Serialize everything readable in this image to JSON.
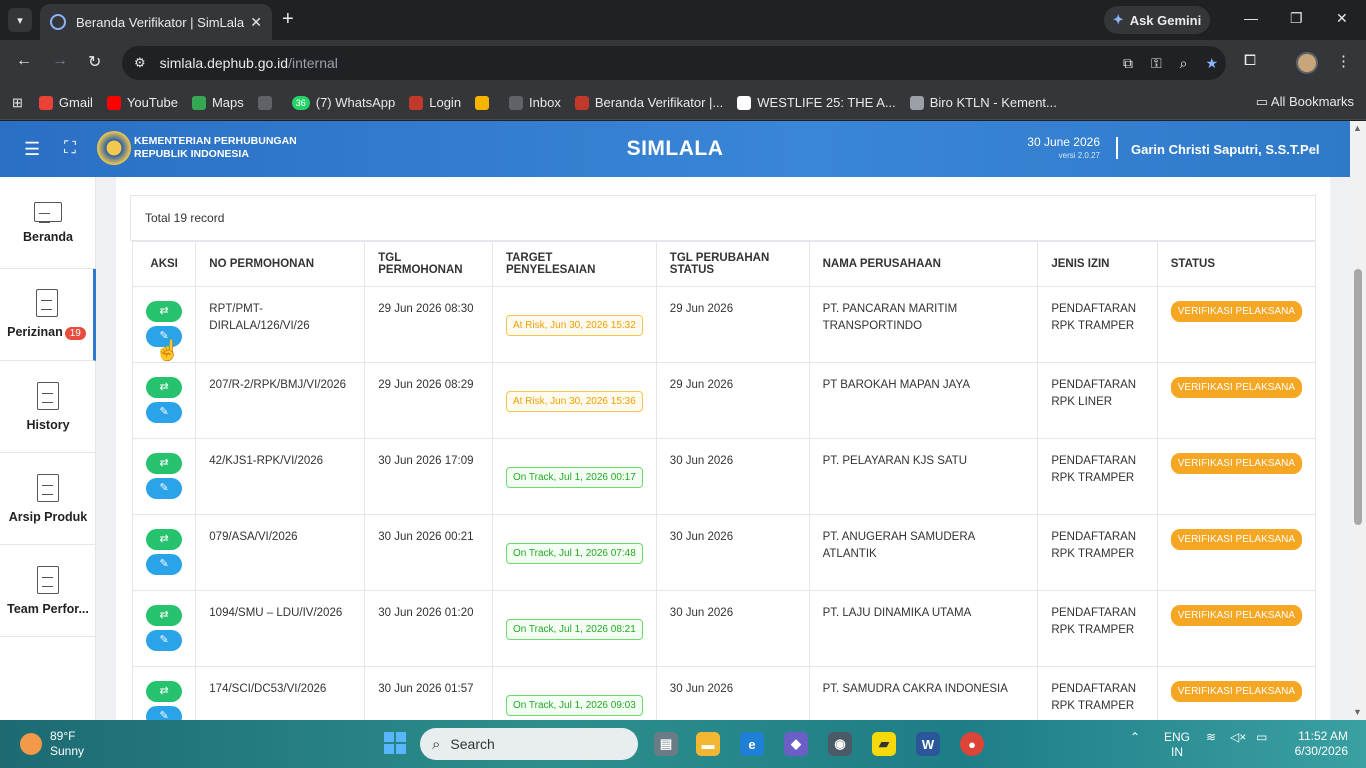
{
  "browser": {
    "tab_title": "Beranda Verifikator | SimLala",
    "gemini_label": "Ask Gemini",
    "url_host": "simlala.dephub.go.id",
    "url_path": "/internal",
    "bookmarks": [
      {
        "label": "Gmail",
        "color": "#ea4335",
        "icon": "gmail-icon"
      },
      {
        "label": "YouTube",
        "color": "#ff0000",
        "icon": "youtube-icon"
      },
      {
        "label": "Maps",
        "color": "#34a853",
        "icon": "maps-icon"
      },
      {
        "label": "",
        "color": "#5f6368",
        "icon": "globe-icon"
      },
      {
        "label": "(7) WhatsApp",
        "color": "#25d366",
        "icon": "whatsapp-icon"
      },
      {
        "label": "Login",
        "color": "#c0392b",
        "icon": "login-icon"
      },
      {
        "label": "",
        "color": "#f4b400",
        "icon": "pinwheel-icon"
      },
      {
        "label": "Inbox",
        "color": "#5f6368",
        "icon": "inbox-icon"
      },
      {
        "label": "Beranda Verifikator |...",
        "color": "#c0392b",
        "icon": "simlala-icon"
      },
      {
        "label": "WESTLIFE 25: THE A...",
        "color": "#ffffff",
        "icon": "bookmark-page-icon"
      },
      {
        "label": "Biro KTLN - Kement...",
        "color": "#9aa0a6",
        "icon": "globe-icon"
      }
    ],
    "all_bookmarks": "All Bookmarks",
    "whatsapp_count": "36"
  },
  "header": {
    "ministry_line1": "KEMENTERIAN PERHUBUNGAN",
    "ministry_line2": "REPUBLIK INDONESIA",
    "app_title": "SIMLALA",
    "date": "30 June 2026",
    "version": "versi 2.0.27",
    "user": "Garin Christi Saputri, S.S.T.Pel"
  },
  "sidebar": {
    "items": [
      {
        "label": "Beranda"
      },
      {
        "label": "Perizinan",
        "badge": "19"
      },
      {
        "label": "History"
      },
      {
        "label": "Arsip Produk"
      },
      {
        "label": "Team Perfor..."
      }
    ]
  },
  "main": {
    "total_records": "Total 19 record",
    "columns": [
      "AKSI",
      "NO PERMOHONAN",
      "TGL PERMOHONAN",
      "TARGET PENYELESAIAN",
      "TGL PERUBAHAN STATUS",
      "NAMA PERUSAHAAN",
      "JENIS IZIN",
      "STATUS"
    ],
    "rows": [
      {
        "no": "RPT/PMT-DIRLALA/126/VI/26",
        "tgl": "29 Jun 2026 08:30",
        "target": "At Risk, Jun 30, 2026 15:32",
        "target_type": "risk",
        "tgl_status": "29 Jun 2026",
        "perusahaan": "PT. PANCARAN MARITIM TRANSPORTINDO",
        "jenis": "PENDAFTARAN RPK TRAMPER",
        "status": "VERIFIKASI PELAKSANA"
      },
      {
        "no": "207/R-2/RPK/BMJ/VI/2026",
        "tgl": "29 Jun 2026 08:29",
        "target": "At Risk, Jun 30, 2026 15:36",
        "target_type": "risk",
        "tgl_status": "29 Jun 2026",
        "perusahaan": "PT BAROKAH MAPAN JAYA",
        "jenis": "PENDAFTARAN RPK LINER",
        "status": "VERIFIKASI PELAKSANA"
      },
      {
        "no": "42/KJS1-RPK/VI/2026",
        "tgl": "30 Jun 2026 17:09",
        "target": "On Track, Jul 1, 2026 00:17",
        "target_type": "track",
        "tgl_status": "30 Jun 2026",
        "perusahaan": "PT. PELAYARAN KJS SATU",
        "jenis": "PENDAFTARAN RPK TRAMPER",
        "status": "VERIFIKASI PELAKSANA"
      },
      {
        "no": "079/ASA/VI/2026",
        "tgl": "30 Jun 2026 00:21",
        "target": "On Track, Jul 1, 2026 07:48",
        "target_type": "track",
        "tgl_status": "30 Jun 2026",
        "perusahaan": "PT. ANUGERAH SAMUDERA ATLANTIK",
        "jenis": "PENDAFTARAN RPK TRAMPER",
        "status": "VERIFIKASI PELAKSANA"
      },
      {
        "no": "1094/SMU – LDU/IV/2026",
        "tgl": "30 Jun 2026 01:20",
        "target": "On Track, Jul 1, 2026 08:21",
        "target_type": "track",
        "tgl_status": "30 Jun 2026",
        "perusahaan": "PT. LAJU DINAMIKA UTAMA",
        "jenis": "PENDAFTARAN RPK TRAMPER",
        "status": "VERIFIKASI PELAKSANA"
      },
      {
        "no": "174/SCI/DC53/VI/2026",
        "tgl": "30 Jun 2026 01:57",
        "target": "On Track, Jul 1, 2026 09:03",
        "target_type": "track",
        "tgl_status": "30 Jun 2026",
        "perusahaan": "PT. SAMUDRA CAKRA INDONESIA",
        "jenis": "PENDAFTARAN RPK TRAMPER",
        "status": "VERIFIKASI PELAKSANA"
      }
    ]
  },
  "taskbar": {
    "temp": "89°F",
    "weather": "Sunny",
    "search_placeholder": "Search",
    "lang1": "ENG",
    "lang2": "IN",
    "time": "11:52 AM",
    "date": "6/30/2026"
  },
  "colors": {
    "header_blue": "#3a86d6",
    "status_orange": "#f5a623",
    "action_green": "#27c26e",
    "action_blue": "#2aa3e8"
  }
}
